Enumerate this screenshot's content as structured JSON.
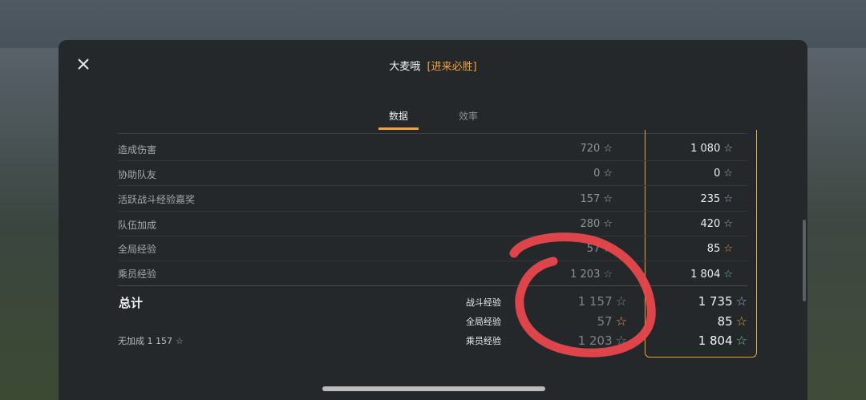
{
  "header": {
    "player": "大麦哦",
    "clan": "[进来必胜]"
  },
  "tabs": [
    {
      "label": "数据",
      "active": true
    },
    {
      "label": "效率",
      "active": false
    }
  ],
  "rows": [
    {
      "label": "造成伤害",
      "base": "720",
      "base_star": "blue",
      "bonus": "1 080",
      "bonus_star": "blue"
    },
    {
      "label": "协助队友",
      "base": "0",
      "base_star": "blue",
      "bonus": "0",
      "bonus_star": "blue"
    },
    {
      "label": "活跃战斗经验嘉奖",
      "base": "157",
      "base_star": "blue",
      "bonus": "235",
      "bonus_star": "blue"
    },
    {
      "label": "队伍加成",
      "base": "280",
      "base_star": "blue",
      "bonus": "420",
      "bonus_star": "blue"
    },
    {
      "label": "全局经验",
      "base": "57",
      "base_star": "gold",
      "bonus": "85",
      "bonus_star": "gold"
    },
    {
      "label": "乘员经验",
      "base": "1 203",
      "base_star": "green",
      "bonus": "1 804",
      "bonus_star": "green"
    }
  ],
  "totals": {
    "label": "总计",
    "no_bonus": "无加成 1 157",
    "items": [
      {
        "label": "战斗经验",
        "base": "1 157",
        "base_star": "blue",
        "bonus": "1 735",
        "bonus_star": "blue"
      },
      {
        "label": "全局经验",
        "base": "57",
        "base_star": "gold",
        "bonus": "85",
        "bonus_star": "gold"
      },
      {
        "label": "乘员经验",
        "base": "1 203",
        "base_star": "green",
        "bonus": "1 804",
        "bonus_star": "green"
      }
    ]
  },
  "star_glyph": "☆",
  "colors": {
    "accent": "#f0a43b",
    "star_blue": "#9cb2c6",
    "star_gold": "#e3a13a",
    "star_green": "#6fc48a",
    "annotation": "#e8474d"
  }
}
